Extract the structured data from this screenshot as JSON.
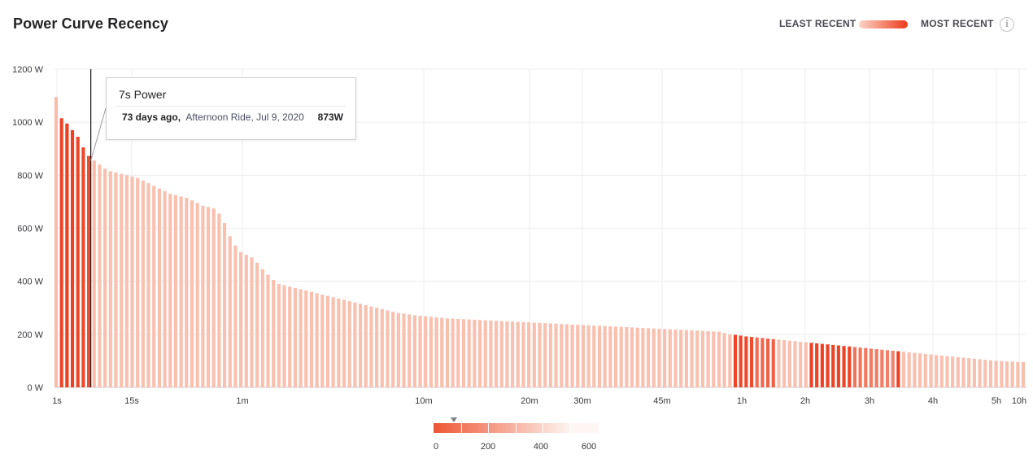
{
  "header": {
    "title": "Power Curve Recency",
    "legend_least": "LEAST RECENT",
    "legend_most": "MOST RECENT",
    "info_icon": "info-icon",
    "gradient_colors": [
      "#fbd5c6",
      "#ee3a1c"
    ]
  },
  "tooltip": {
    "title": "7s Power",
    "when": "73 days ago,",
    "activity": "Afternoon Ride, Jul 9, 2020",
    "value": "873W"
  },
  "scale": {
    "ticks": [
      "0",
      "200",
      "400",
      "600"
    ],
    "marker_days": 73,
    "max_days": 600
  },
  "chart_data": {
    "type": "bar",
    "title": "Power Curve Recency",
    "y_unit": "W",
    "ylim": [
      0,
      1200
    ],
    "yticks": [
      0,
      200,
      400,
      600,
      800,
      1000,
      1200
    ],
    "ytick_labels": [
      "0 W",
      "200 W",
      "400 W",
      "600 W",
      "800 W",
      "1000 W",
      "1200 W"
    ],
    "x_scale": "log",
    "x_unit": "seconds",
    "x_ticks": [
      {
        "label": "1s",
        "seconds": 1
      },
      {
        "label": "15s",
        "seconds": 15
      },
      {
        "label": "1m",
        "seconds": 60
      },
      {
        "label": "10m",
        "seconds": 600
      },
      {
        "label": "20m",
        "seconds": 1200
      },
      {
        "label": "30m",
        "seconds": 1800
      },
      {
        "label": "45m",
        "seconds": 2700
      },
      {
        "label": "1h",
        "seconds": 3600
      },
      {
        "label": "2h",
        "seconds": 7200
      },
      {
        "label": "3h",
        "seconds": 10800
      },
      {
        "label": "4h",
        "seconds": 14400
      },
      {
        "label": "5h",
        "seconds": 18000
      },
      {
        "label": "10h",
        "seconds": 36000
      }
    ],
    "grid": true,
    "color_scale": {
      "min_days": 0,
      "max_days": 600,
      "recent_color": "#ee3a1c",
      "old_color": "#fbd5c6"
    },
    "selected_duration_s": 7,
    "bars": {
      "power_w": [
        1095,
        1015,
        995,
        970,
        945,
        905,
        873,
        855,
        840,
        825,
        815,
        810,
        805,
        800,
        795,
        790,
        780,
        770,
        760,
        750,
        740,
        730,
        725,
        720,
        715,
        705,
        695,
        685,
        680,
        675,
        655,
        620,
        570,
        535,
        510,
        500,
        490,
        470,
        445,
        425,
        405,
        390,
        385,
        380,
        375,
        370,
        365,
        360,
        355,
        350,
        345,
        340,
        335,
        330,
        325,
        320,
        315,
        310,
        305,
        300,
        295,
        290,
        285,
        280,
        278,
        275,
        272,
        270,
        268,
        266,
        264,
        262,
        260,
        259,
        258,
        257,
        256,
        255,
        254,
        253,
        252,
        251,
        250,
        249,
        248,
        247,
        246,
        245,
        244,
        243,
        242,
        241,
        240,
        239,
        238,
        237,
        236,
        235,
        234,
        233,
        232,
        231,
        230,
        229,
        228,
        227,
        226,
        225,
        224,
        223,
        222,
        221,
        220,
        219,
        218,
        217,
        216,
        215,
        214,
        213,
        212,
        211,
        210,
        205,
        200,
        198,
        195,
        192,
        190,
        188,
        186,
        184,
        182,
        180,
        178,
        176,
        174,
        172,
        170,
        168,
        166,
        164,
        162,
        160,
        158,
        156,
        154,
        152,
        150,
        148,
        146,
        144,
        142,
        140,
        138,
        136,
        134,
        132,
        130,
        128,
        126,
        124,
        122,
        120,
        118,
        116,
        114,
        112,
        110,
        108,
        106,
        104,
        102,
        100,
        99,
        98,
        97,
        96,
        95
      ],
      "days_ago": [
        500,
        30,
        10,
        25,
        45,
        50,
        73,
        500,
        520,
        520,
        520,
        520,
        520,
        520,
        520,
        520,
        520,
        520,
        520,
        520,
        520,
        520,
        520,
        520,
        520,
        520,
        520,
        520,
        520,
        520,
        520,
        520,
        520,
        520,
        520,
        520,
        520,
        520,
        520,
        520,
        520,
        520,
        520,
        520,
        520,
        520,
        520,
        520,
        520,
        520,
        520,
        520,
        520,
        520,
        520,
        520,
        520,
        520,
        520,
        520,
        520,
        520,
        520,
        520,
        520,
        520,
        520,
        520,
        520,
        520,
        520,
        520,
        520,
        520,
        520,
        520,
        520,
        520,
        520,
        520,
        520,
        520,
        520,
        520,
        520,
        520,
        520,
        520,
        520,
        520,
        520,
        520,
        520,
        520,
        520,
        520,
        520,
        520,
        520,
        520,
        520,
        520,
        520,
        520,
        520,
        520,
        520,
        520,
        520,
        520,
        520,
        520,
        520,
        520,
        520,
        520,
        520,
        520,
        520,
        520,
        520,
        520,
        520,
        520,
        520,
        40,
        45,
        55,
        60,
        200,
        170,
        150,
        140,
        520,
        520,
        520,
        520,
        520,
        520,
        30,
        30,
        30,
        30,
        35,
        35,
        30,
        40,
        220,
        230,
        240,
        250,
        250,
        260,
        270,
        280,
        20,
        520,
        520,
        520,
        520,
        520,
        520,
        520,
        520,
        520,
        520,
        520,
        520,
        520,
        520,
        520,
        520,
        520,
        520,
        520,
        520,
        520,
        520,
        520,
        520,
        520,
        520,
        520
      ]
    }
  }
}
